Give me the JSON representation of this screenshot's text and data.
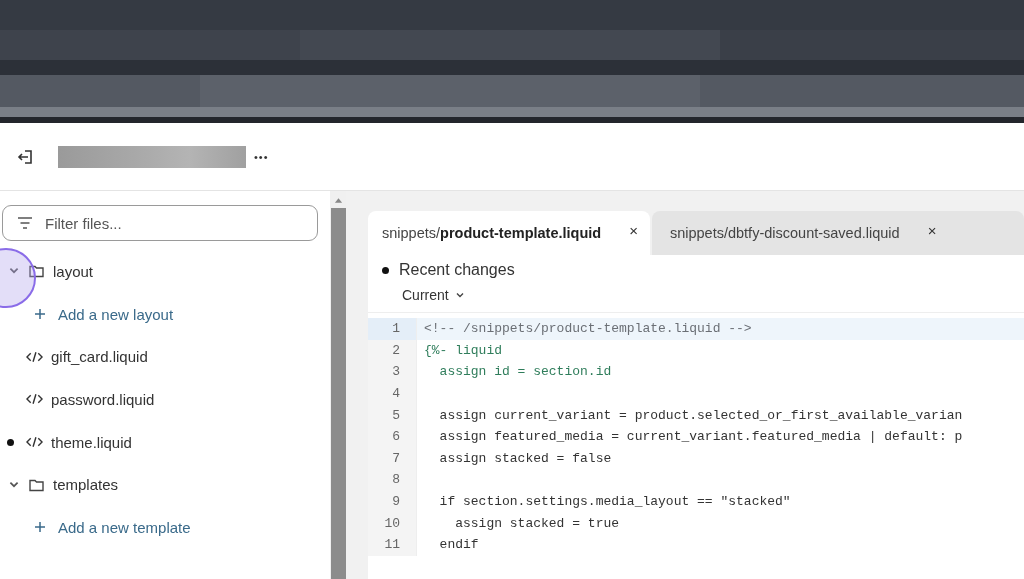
{
  "header": {
    "more_label": "•••"
  },
  "sidebar": {
    "filter": {
      "placeholder": "Filter files..."
    },
    "tree": [
      {
        "kind": "folder",
        "label": "layout",
        "expanded": true,
        "children": [
          {
            "kind": "add",
            "label": "Add a new layout",
            "modified": false
          },
          {
            "kind": "file",
            "label": "gift_card.liquid",
            "modified": false
          },
          {
            "kind": "file",
            "label": "password.liquid",
            "modified": false
          },
          {
            "kind": "file",
            "label": "theme.liquid",
            "modified": true
          }
        ]
      },
      {
        "kind": "folder",
        "label": "templates",
        "expanded": true,
        "children": [
          {
            "kind": "add",
            "label": "Add a new template",
            "modified": false
          }
        ]
      }
    ]
  },
  "editor": {
    "tabs": [
      {
        "label": "snippets/**product-template.liquid**",
        "selected": true,
        "close": "×"
      },
      {
        "label": "snippets/dbtfy-discount-saved.liquid",
        "selected": false,
        "close": "×"
      }
    ],
    "recent_changes": "Recent changes",
    "version": "Current",
    "lines": [
      {
        "number": "1",
        "text": "<!-- /snippets/product-template.liquid -->",
        "kind": "comment",
        "selected": true
      },
      {
        "number": "2",
        "text": "{%- liquid",
        "kind": "tag",
        "selected": false
      },
      {
        "number": "3",
        "text": "  assign id = section.id",
        "kind": "tag",
        "selected": false
      },
      {
        "number": "4",
        "selected": false
      },
      {
        "number": "5",
        "text": "  assign current_variant = product.selected_or_first_available_varian",
        "kind": "plain",
        "selected": false
      },
      {
        "number": "6",
        "text": "  assign featured_media = current_variant.featured_media | default: p",
        "kind": "plain",
        "selected": false
      },
      {
        "number": "7",
        "text": "  assign stacked = false",
        "kind": "plain",
        "selected": false
      },
      {
        "number": "8",
        "selected": false
      },
      {
        "number": "9",
        "text": "  if section.settings.media_layout == \"stacked\"",
        "kind": "plain",
        "selected": false
      },
      {
        "number": "10",
        "text": "    assign stacked = true",
        "kind": "plain",
        "selected": false
      },
      {
        "number": "11",
        "text": "  endif",
        "kind": "plain",
        "selected": false
      }
    ]
  }
}
